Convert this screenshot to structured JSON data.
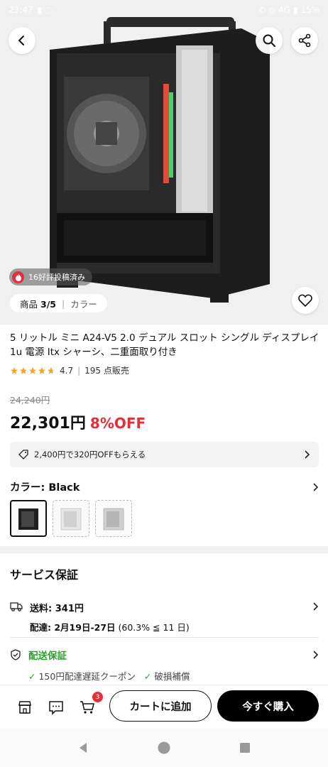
{
  "status_bar": {
    "time": "23:47",
    "indicators_left": "▮ ◌",
    "indicators_right": "✆ ◎ 4G ▮ 15%"
  },
  "hero": {
    "reviews_badge": "16好評投稿済み",
    "counter_label": "商品",
    "counter_value": "3/5",
    "color_tab": "カラー"
  },
  "product": {
    "title": "5 リットル ミニ A24-V5 2.0 デュアル スロット シングル ディスプレイ 1u 電源 Itx シャーシ、二重面取り付き",
    "rating": "4.7",
    "stars": 4.7,
    "sold": "195 点販売",
    "old_price": "24,240円",
    "price": "22,301円",
    "discount": "8%OFF",
    "coupon": "2,400円で320円OFFもらえる"
  },
  "color": {
    "label": "カラー: Black",
    "swatches": [
      "black",
      "white",
      "silver"
    ]
  },
  "service": {
    "title": "サービス保証",
    "shipping_fee": "送料: 341円",
    "delivery_label": "配達: ",
    "delivery_dates": "2月19日-27日",
    "delivery_rate": " (60.3% ≦ 11 日)",
    "guarantee": "配送保証",
    "guarantee_items": [
      "150円配達遅延クーポン",
      "破損補償"
    ]
  },
  "actions": {
    "cart_count": "3",
    "add_to_cart": "カートに追加",
    "buy_now": "今すぐ購入"
  },
  "colors": {
    "accent_red": "#e0303b",
    "accent_green": "#2aa22a",
    "primary_black": "#000000"
  }
}
